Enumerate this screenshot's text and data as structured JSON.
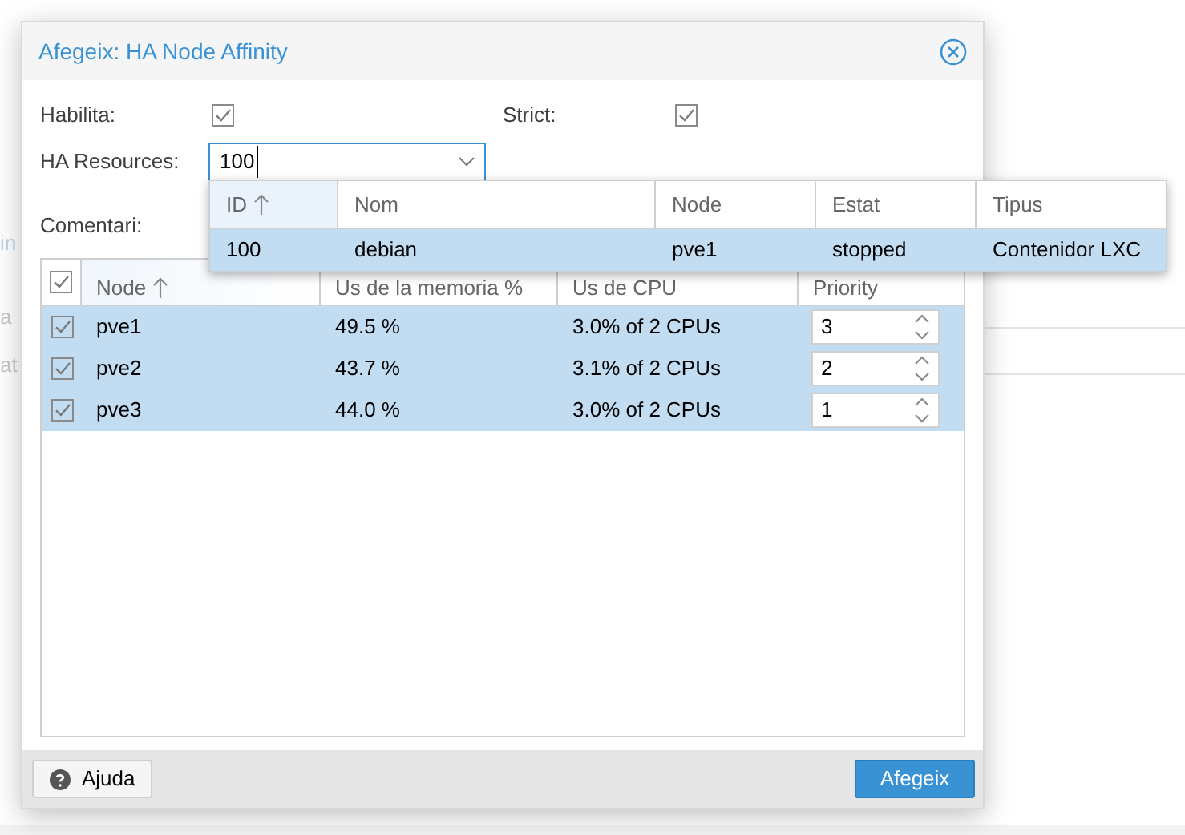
{
  "background": {
    "fragments": [
      {
        "text": "in",
        "kind": "link"
      },
      {
        "text": "a",
        "kind": "plain"
      },
      {
        "text": "at",
        "kind": "plain"
      }
    ]
  },
  "dialog": {
    "title": "Afegeix: HA Node Affinity",
    "fields": [
      {
        "kind": "checkbox",
        "label": "Habilita:",
        "checked": true
      },
      {
        "kind": "checkbox",
        "label": "Strict:",
        "checked": true
      },
      {
        "kind": "combo",
        "label": "HA Resources:",
        "value": "100"
      },
      {
        "kind": "text",
        "label": "Comentari:"
      }
    ],
    "dropdown": {
      "columns": [
        {
          "label": "ID",
          "sorted": true
        },
        {
          "label": "Nom",
          "sorted": false
        },
        {
          "label": "Node",
          "sorted": false
        },
        {
          "label": "Estat",
          "sorted": false
        },
        {
          "label": "Tipus",
          "sorted": false
        }
      ],
      "rows": [
        {
          "cells": [
            "100",
            "debian",
            "pve1",
            "stopped",
            "Contenidor LXC"
          ],
          "selected": true
        }
      ]
    },
    "grid": {
      "all_checked": true,
      "columns": [
        {
          "label": "Node",
          "sorted": true
        },
        {
          "label": "Us de la memoria %",
          "sorted": false
        },
        {
          "label": "Us de CPU",
          "sorted": false
        },
        {
          "label": "Priority",
          "sorted": false
        }
      ],
      "rows": [
        {
          "checked": true,
          "selected": true,
          "node": "pve1",
          "memory": "49.5 %",
          "cpu": "3.0% of 2 CPUs",
          "priority": "3"
        },
        {
          "checked": true,
          "selected": true,
          "node": "pve2",
          "memory": "43.7 %",
          "cpu": "3.1% of 2 CPUs",
          "priority": "2"
        },
        {
          "checked": true,
          "selected": true,
          "node": "pve3",
          "memory": "44.0 %",
          "cpu": "3.0% of 2 CPUs",
          "priority": "1"
        }
      ]
    },
    "buttons": [
      {
        "kind": "help",
        "label": "Ajuda"
      },
      {
        "kind": "primary",
        "label": "Afegeix"
      }
    ]
  }
}
